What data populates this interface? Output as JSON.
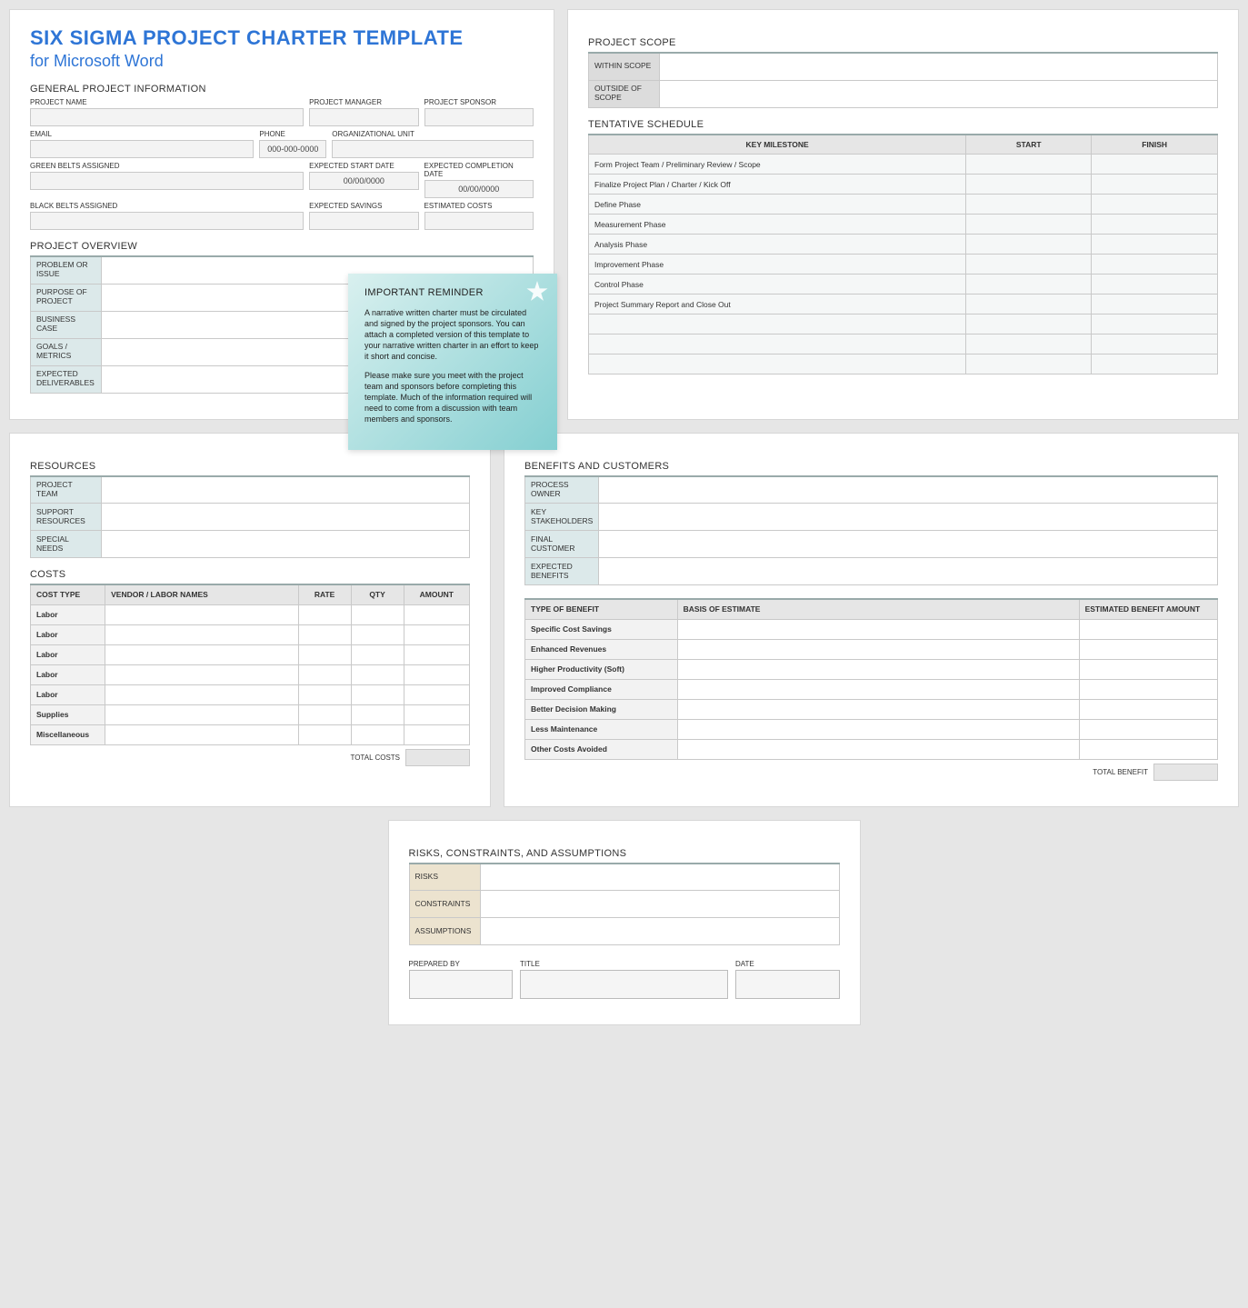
{
  "title": "SIX SIGMA PROJECT CHARTER TEMPLATE",
  "subtitle": "for Microsoft Word",
  "general": {
    "heading": "GENERAL PROJECT INFORMATION",
    "labels": {
      "project_name": "PROJECT NAME",
      "project_manager": "PROJECT MANAGER",
      "project_sponsor": "PROJECT SPONSOR",
      "email": "EMAIL",
      "phone": "PHONE",
      "org_unit": "ORGANIZATIONAL UNIT",
      "green_belts": "GREEN BELTS ASSIGNED",
      "expected_start": "EXPECTED START DATE",
      "expected_completion": "EXPECTED COMPLETION DATE",
      "black_belts": "BLACK BELTS ASSIGNED",
      "expected_savings": "EXPECTED SAVINGS",
      "estimated_costs": "ESTIMATED COSTS"
    },
    "values": {
      "phone": "000-000-0000",
      "expected_start": "00/00/0000",
      "expected_completion": "00/00/0000"
    }
  },
  "overview": {
    "heading": "PROJECT OVERVIEW",
    "rows": [
      "PROBLEM OR ISSUE",
      "PURPOSE OF PROJECT",
      "BUSINESS CASE",
      "GOALS / METRICS",
      "EXPECTED DELIVERABLES"
    ]
  },
  "reminder": {
    "title": "IMPORTANT REMINDER",
    "p1": "A narrative written charter must be circulated and signed by the project sponsors. You can attach a completed version of this template to your narrative written charter in an effort to keep it short and concise.",
    "p2": "Please make sure you meet with the project team and sponsors before completing this template. Much of the information required will need to come from a discussion with team members and sponsors."
  },
  "scope": {
    "heading": "PROJECT SCOPE",
    "rows": [
      "WITHIN SCOPE",
      "OUTSIDE OF SCOPE"
    ]
  },
  "schedule": {
    "heading": "TENTATIVE SCHEDULE",
    "cols": [
      "KEY MILESTONE",
      "START",
      "FINISH"
    ],
    "rows": [
      "Form Project Team / Preliminary Review / Scope",
      "Finalize Project Plan / Charter / Kick Off",
      "Define Phase",
      "Measurement Phase",
      "Analysis Phase",
      "Improvement Phase",
      "Control Phase",
      "Project Summary Report and Close Out",
      "",
      "",
      ""
    ]
  },
  "resources": {
    "heading": "RESOURCES",
    "rows": [
      "PROJECT TEAM",
      "SUPPORT RESOURCES",
      "SPECIAL NEEDS"
    ]
  },
  "costs": {
    "heading": "COSTS",
    "cols": [
      "COST TYPE",
      "VENDOR / LABOR NAMES",
      "RATE",
      "QTY",
      "AMOUNT"
    ],
    "rows": [
      "Labor",
      "Labor",
      "Labor",
      "Labor",
      "Labor",
      "Supplies",
      "Miscellaneous"
    ],
    "total_label": "TOTAL COSTS"
  },
  "benefits_customers": {
    "heading": "BENEFITS AND CUSTOMERS",
    "rows": [
      "PROCESS OWNER",
      "KEY STAKEHOLDERS",
      "FINAL CUSTOMER",
      "EXPECTED BENEFITS"
    ]
  },
  "benefits_table": {
    "cols": [
      "TYPE OF BENEFIT",
      "BASIS OF ESTIMATE",
      "ESTIMATED BENEFIT AMOUNT"
    ],
    "rows": [
      "Specific Cost Savings",
      "Enhanced Revenues",
      "Higher Productivity (Soft)",
      "Improved Compliance",
      "Better Decision Making",
      "Less Maintenance",
      "Other Costs Avoided"
    ],
    "total_label": "TOTAL BENEFIT"
  },
  "risks": {
    "heading": "RISKS, CONSTRAINTS, AND ASSUMPTIONS",
    "rows": [
      "RISKS",
      "CONSTRAINTS",
      "ASSUMPTIONS"
    ]
  },
  "signoff": {
    "labels": [
      "PREPARED BY",
      "TITLE",
      "DATE"
    ]
  }
}
